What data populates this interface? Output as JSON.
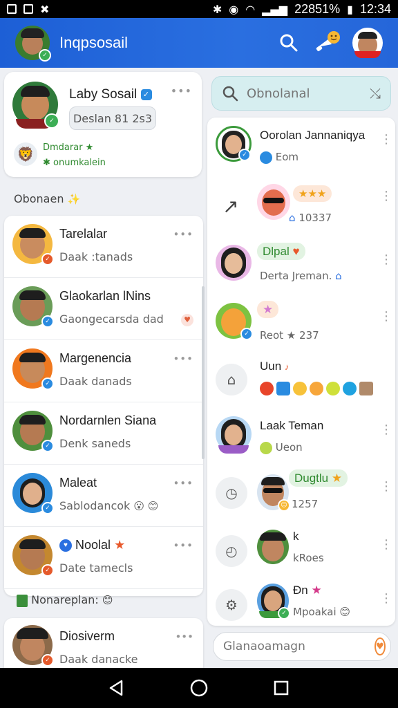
{
  "status_bar": {
    "percent": "22851%",
    "time": "12:34"
  },
  "app_bar": {
    "title": "Inqpsosail"
  },
  "profile_card": {
    "name": "Laby Sosail",
    "pill": "Deslan 81 2s3",
    "more": "•••",
    "line1": "Dmdarar ★",
    "line2": "✱ onumkalein"
  },
  "left_section_label": "Obonaen",
  "contacts": [
    {
      "name": "Tarelalar",
      "sub": "Daak :tanads",
      "skin": "#c98c5f",
      "bg": "#f4b840",
      "badge": "#e55a2b"
    },
    {
      "name": "Glaokarlan lNins",
      "sub": "Gaongecarsda dad",
      "skin": "#b57a52",
      "bg": "#6a9c58",
      "badge": "#2a8be0"
    },
    {
      "name": "Margenencia",
      "sub": "Daak danads",
      "skin": "#c78a5b",
      "bg": "#f0781e",
      "badge": "#2a8be0"
    },
    {
      "name": "Nordarnlen Siana",
      "sub": "Denk saneds",
      "skin": "#b57a52",
      "bg": "#4f8f3d",
      "badge": "#2a8be0"
    },
    {
      "name": "Maleat",
      "sub": "Sablodancok",
      "skin": "#e0b08c",
      "bg": "#2b8ad9",
      "badge": "#2a8be0"
    },
    {
      "name": "Noolal",
      "sub": "Date tamecls",
      "skin": "#b57a52",
      "bg": "#c4882f",
      "badge": "#e55a2b"
    }
  ],
  "left_section_label2": "Nonareplan:",
  "bottom_contact": {
    "name": "Diosiverm",
    "sub": "Daak danacke"
  },
  "search": {
    "placeholder": "Obnolanal"
  },
  "chats": [
    {
      "name": "Oorolan Jannaniqya",
      "sub": "Eom"
    },
    {
      "name": "★★★",
      "sub": "10337"
    },
    {
      "name": "Dlpal",
      "sub": "Derta Jreman."
    },
    {
      "name": "★",
      "sub": "Reot ★ 237"
    },
    {
      "name": "Uun",
      "sub": ""
    },
    {
      "name": "Laak Teman",
      "sub": "Ueon"
    },
    {
      "name": "Dugtlu",
      "sub": "1257"
    },
    {
      "name": "k",
      "sub": "kRoes"
    },
    {
      "name": "Ðn",
      "sub": "Mpoakai"
    }
  ],
  "compose": {
    "placeholder": "Glanaoamagn"
  },
  "colors": {
    "app_bar": "#1d5fd6",
    "accent": "#2a8be0",
    "green": "#2f8a2f"
  }
}
